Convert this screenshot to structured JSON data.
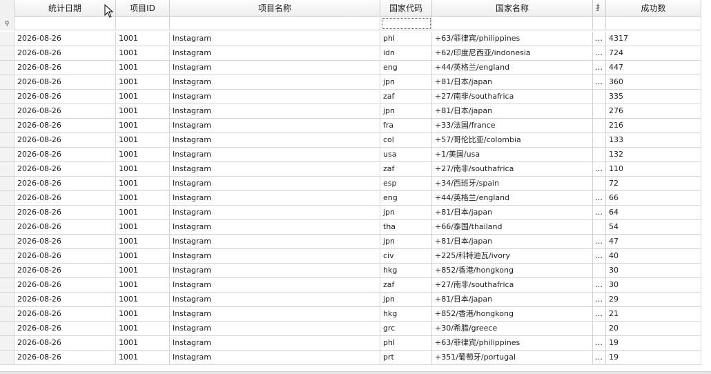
{
  "grid": {
    "columns": {
      "date": "统计日期",
      "project_id": "项目ID",
      "project_name": "项目名称",
      "country_code": "国家代码",
      "country_name": "国家名称",
      "truncated": "扌",
      "success_count": "成功数"
    },
    "filter_icon": "pin-icon",
    "rows": [
      {
        "date": "2026-08-26",
        "pid": "1001",
        "pname": "Instagram",
        "code": "phl",
        "cname": "+63/菲律宾/philippines",
        "ext": "…",
        "succ": "4317"
      },
      {
        "date": "2026-08-26",
        "pid": "1001",
        "pname": "Instagram",
        "code": "idn",
        "cname": "+62/印度尼西亚/indonesia",
        "ext": "…",
        "succ": "724"
      },
      {
        "date": "2026-08-26",
        "pid": "1001",
        "pname": "Instagram",
        "code": "eng",
        "cname": "+44/英格兰/england",
        "ext": "…",
        "succ": "447"
      },
      {
        "date": "2026-08-26",
        "pid": "1001",
        "pname": "Instagram",
        "code": "jpn",
        "cname": "+81/日本/japan",
        "ext": "…",
        "succ": "360"
      },
      {
        "date": "2026-08-26",
        "pid": "1001",
        "pname": "Instagram",
        "code": "zaf",
        "cname": "+27/南非/southafrica",
        "ext": "",
        "succ": "335"
      },
      {
        "date": "2026-08-26",
        "pid": "1001",
        "pname": "Instagram",
        "code": "jpn",
        "cname": "+81/日本/japan",
        "ext": "",
        "succ": "276"
      },
      {
        "date": "2026-08-26",
        "pid": "1001",
        "pname": "Instagram",
        "code": "fra",
        "cname": "+33/法国/france",
        "ext": "",
        "succ": "216"
      },
      {
        "date": "2026-08-26",
        "pid": "1001",
        "pname": "Instagram",
        "code": "col",
        "cname": "+57/哥伦比亚/colombia",
        "ext": "",
        "succ": "133"
      },
      {
        "date": "2026-08-26",
        "pid": "1001",
        "pname": "Instagram",
        "code": "usa",
        "cname": "+1/美国/usa",
        "ext": "",
        "succ": "132"
      },
      {
        "date": "2026-08-26",
        "pid": "1001",
        "pname": "Instagram",
        "code": "zaf",
        "cname": "+27/南非/southafrica",
        "ext": "…",
        "succ": "110"
      },
      {
        "date": "2026-08-26",
        "pid": "1001",
        "pname": "Instagram",
        "code": "esp",
        "cname": "+34/西班牙/spain",
        "ext": "",
        "succ": "72"
      },
      {
        "date": "2026-08-26",
        "pid": "1001",
        "pname": "Instagram",
        "code": "eng",
        "cname": "+44/英格兰/england",
        "ext": "…",
        "succ": "66"
      },
      {
        "date": "2026-08-26",
        "pid": "1001",
        "pname": "Instagram",
        "code": "jpn",
        "cname": "+81/日本/japan",
        "ext": "…",
        "succ": "64"
      },
      {
        "date": "2026-08-26",
        "pid": "1001",
        "pname": "Instagram",
        "code": "tha",
        "cname": "+66/泰国/thailand",
        "ext": "",
        "succ": "54"
      },
      {
        "date": "2026-08-26",
        "pid": "1001",
        "pname": "Instagram",
        "code": "jpn",
        "cname": "+81/日本/japan",
        "ext": "…",
        "succ": "47"
      },
      {
        "date": "2026-08-26",
        "pid": "1001",
        "pname": "Instagram",
        "code": "civ",
        "cname": "+225/科特迪瓦/ivory",
        "ext": "…",
        "succ": "40"
      },
      {
        "date": "2026-08-26",
        "pid": "1001",
        "pname": "Instagram",
        "code": "hkg",
        "cname": "+852/香港/hongkong",
        "ext": "",
        "succ": "30"
      },
      {
        "date": "2026-08-26",
        "pid": "1001",
        "pname": "Instagram",
        "code": "zaf",
        "cname": "+27/南非/southafrica",
        "ext": "…",
        "succ": "30"
      },
      {
        "date": "2026-08-26",
        "pid": "1001",
        "pname": "Instagram",
        "code": "jpn",
        "cname": "+81/日本/japan",
        "ext": "…",
        "succ": "29"
      },
      {
        "date": "2026-08-26",
        "pid": "1001",
        "pname": "Instagram",
        "code": "hkg",
        "cname": "+852/香港/hongkong",
        "ext": "…",
        "succ": "21"
      },
      {
        "date": "2026-08-26",
        "pid": "1001",
        "pname": "Instagram",
        "code": "grc",
        "cname": "+30/希腊/greece",
        "ext": "",
        "succ": "20"
      },
      {
        "date": "2026-08-26",
        "pid": "1001",
        "pname": "Instagram",
        "code": "phl",
        "cname": "+63/菲律宾/philippines",
        "ext": "…",
        "succ": "19"
      },
      {
        "date": "2026-08-26",
        "pid": "1001",
        "pname": "Instagram",
        "code": "prt",
        "cname": "+351/葡萄牙/portugal",
        "ext": "…",
        "succ": "19"
      }
    ],
    "colors": {
      "grid_line": "#d4d4d4",
      "header_bg": "#eeeeee",
      "indicator_bg": "#f3f3f3"
    }
  }
}
